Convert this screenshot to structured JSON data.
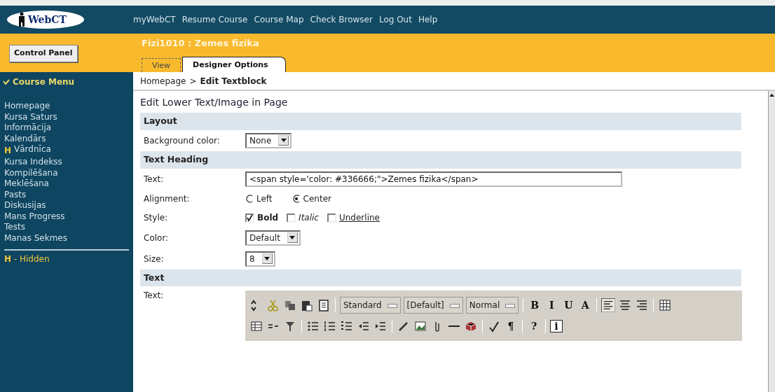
{
  "header": {
    "logo": "WebCT",
    "nav": [
      "myWebCT",
      "Resume Course",
      "Course Map",
      "Check Browser",
      "Log Out",
      "Help"
    ]
  },
  "control_panel": "Control Panel",
  "course": {
    "title": "Fizi1010 : Zemes fizika",
    "tabs": [
      {
        "label": "View",
        "selected": false
      },
      {
        "label": "Designer Options",
        "selected": true
      }
    ]
  },
  "sidebar": {
    "heading": "Course Menu",
    "items": [
      {
        "label": "Homepage"
      },
      {
        "label": "Kursa Saturs"
      },
      {
        "label": "Informācija"
      },
      {
        "label": "Kalendārs"
      },
      {
        "label": "Vārdnīca",
        "flag": "H"
      },
      {
        "label": "Kursa Indekss"
      },
      {
        "label": "Kompilēšana"
      },
      {
        "label": "Meklēšana"
      },
      {
        "label": "Pasts"
      },
      {
        "label": "Diskusijas"
      },
      {
        "label": "Mans Progress"
      },
      {
        "label": "Tests"
      },
      {
        "label": "Manas Sekmes"
      }
    ],
    "legend": "**H** - Hidden"
  },
  "breadcrumb": [
    {
      "label": "Homepage",
      "kind": "link"
    },
    {
      "label": ">",
      "kind": "sep"
    },
    {
      "label": "Edit Textblock",
      "kind": "current"
    }
  ],
  "page_title": "Edit Lower Text/Image in Page",
  "sections": [
    {
      "heading": "Layout",
      "rows": [
        {
          "kind": "select",
          "label": "Background color:",
          "value": "None"
        }
      ]
    },
    {
      "heading": "Text Heading",
      "rows": [
        {
          "kind": "text",
          "label": "Text:",
          "value": "<span style='color: #336666;\">Zemes fizika</span>"
        },
        {
          "kind": "radio",
          "label": "Alignment:",
          "options": [
            {
              "label": "Left",
              "selected": false
            },
            {
              "label": "Center",
              "selected": true
            }
          ]
        },
        {
          "kind": "checks",
          "label": "Style:",
          "options": [
            {
              "label": "Bold",
              "checked": true,
              "kind": "bold"
            },
            {
              "label": "Italic",
              "checked": false,
              "kind": "italic"
            },
            {
              "label": "Underline",
              "checked": false,
              "kind": "underline"
            }
          ]
        },
        {
          "kind": "select",
          "label": "Color:",
          "value": "Default"
        },
        {
          "kind": "select",
          "label": "Size:",
          "value": "8"
        }
      ]
    },
    {
      "heading": "Text",
      "rows": [
        {
          "kind": "editor",
          "label": "Text:"
        }
      ]
    }
  ],
  "toolbar": {
    "rows": [
      [
        {
          "kind": "icon"
        },
        {
          "kind": "icon"
        },
        {
          "kind": "icon"
        },
        {
          "kind": "icon"
        },
        {
          "kind": "icon"
        },
        {
          "kind": "sep"
        },
        {
          "kind": "select",
          "text": "Standard"
        },
        {
          "kind": "select",
          "text": "[Default]"
        },
        {
          "kind": "select",
          "text": "Normal"
        },
        {
          "kind": "sep"
        },
        {
          "kind": "glyph",
          "text": "B"
        },
        {
          "kind": "glyph",
          "text": "I"
        },
        {
          "kind": "glyph",
          "text": "U"
        },
        {
          "kind": "glyph",
          "text": "A"
        },
        {
          "kind": "sep"
        },
        {
          "kind": "icon",
          "selected": true
        },
        {
          "kind": "icon",
          "selected": false
        },
        {
          "kind": "icon",
          "selected": false
        },
        {
          "kind": "sep"
        },
        {
          "kind": "icon"
        }
      ],
      [
        {
          "kind": "icon"
        },
        {
          "kind": "icon"
        },
        {
          "kind": "icon"
        },
        {
          "kind": "sep"
        },
        {
          "kind": "icon"
        },
        {
          "kind": "icon"
        },
        {
          "kind": "icon"
        },
        {
          "kind": "icon"
        },
        {
          "kind": "icon"
        },
        {
          "kind": "sep"
        },
        {
          "kind": "icon"
        },
        {
          "kind": "icon"
        },
        {
          "kind": "icon"
        },
        {
          "kind": "icon"
        },
        {
          "kind": "icon"
        },
        {
          "kind": "sep"
        },
        {
          "kind": "icon"
        },
        {
          "kind": "glyph",
          "text": "¶"
        },
        {
          "kind": "sep"
        },
        {
          "kind": "glyph",
          "text": "?"
        },
        {
          "kind": "sep"
        },
        {
          "kind": "boxed",
          "text": "i"
        }
      ]
    ]
  }
}
